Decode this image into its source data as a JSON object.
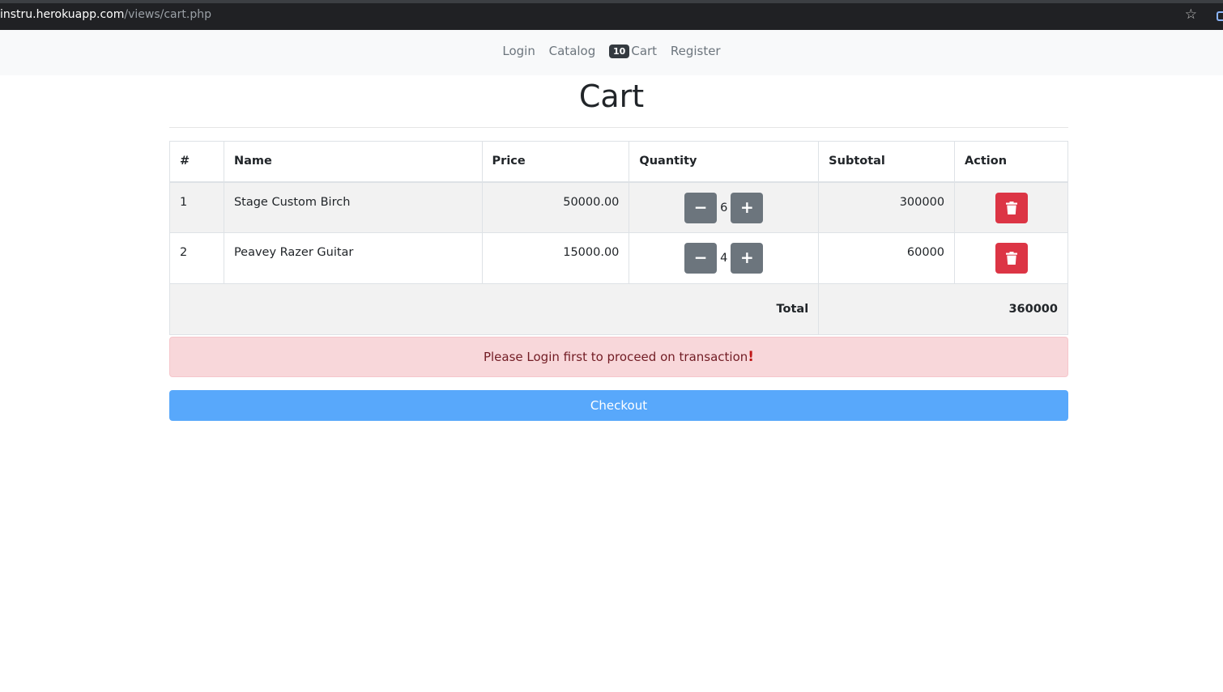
{
  "browser": {
    "url_host": "instru.herokuapp.com",
    "url_path": "/views/cart.php",
    "star_icon": "star-icon"
  },
  "nav": {
    "login": "Login",
    "catalog": "Catalog",
    "cart_badge": "10",
    "cart": "Cart",
    "register": "Register"
  },
  "page": {
    "title": "Cart"
  },
  "table": {
    "headers": [
      "#",
      "Name",
      "Price",
      "Quantity",
      "Subtotal",
      "Action"
    ],
    "rows": [
      {
        "index": "1",
        "name": "Stage Custom Birch",
        "price": "50000.00",
        "quantity": "6",
        "subtotal": "300000"
      },
      {
        "index": "2",
        "name": "Peavey Razer Guitar",
        "price": "15000.00",
        "quantity": "4",
        "subtotal": "60000"
      }
    ],
    "total_label": "Total",
    "total_value": "360000"
  },
  "alert": {
    "message": "Please Login first to proceed on transaction",
    "icon": "exclamation-icon"
  },
  "checkout": {
    "label": "Checkout"
  },
  "colors": {
    "danger": "#dc3545",
    "secondary": "#6c757d",
    "primary_light": "#58a8fb",
    "alert_bg": "#f8d7da"
  }
}
